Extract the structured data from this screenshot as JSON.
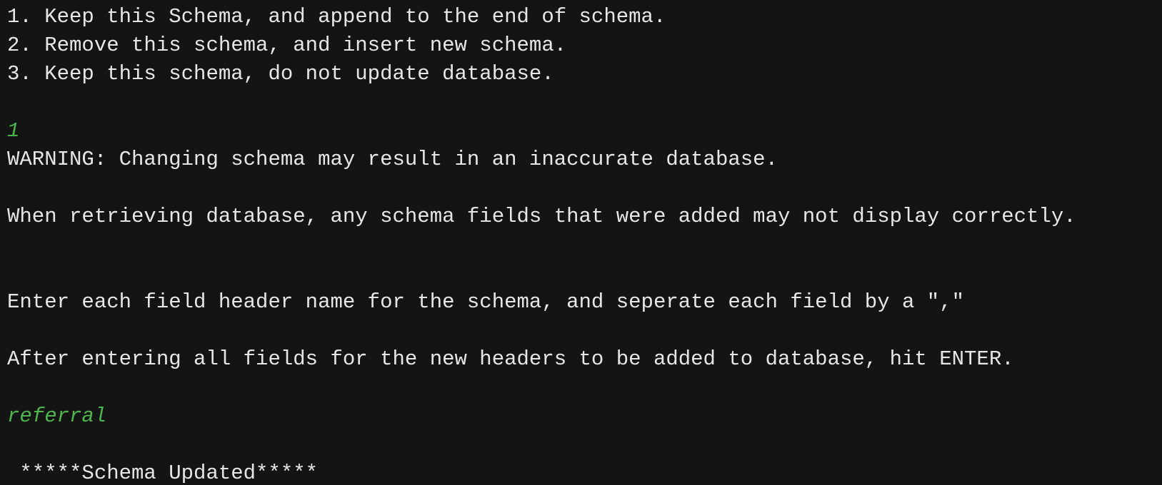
{
  "terminal": {
    "lines": [
      {
        "text": "1. Keep this Schema, and append to the end of schema.",
        "kind": "output"
      },
      {
        "text": "2. Remove this schema, and insert new schema.",
        "kind": "output"
      },
      {
        "text": "3. Keep this schema, do not update database.",
        "kind": "output"
      },
      {
        "text": "",
        "kind": "blank"
      },
      {
        "text": "1",
        "kind": "input"
      },
      {
        "text": "WARNING: Changing schema may result in an inaccurate database.",
        "kind": "output"
      },
      {
        "text": "",
        "kind": "blank"
      },
      {
        "text": "When retrieving database, any schema fields that were added may not display correctly.",
        "kind": "output"
      },
      {
        "text": "",
        "kind": "blank"
      },
      {
        "text": "",
        "kind": "blank"
      },
      {
        "text": "Enter each field header name for the schema, and seperate each field by a \",\"",
        "kind": "output"
      },
      {
        "text": "",
        "kind": "blank"
      },
      {
        "text": "After entering all fields for the new headers to be added to database, hit ENTER.",
        "kind": "output"
      },
      {
        "text": "",
        "kind": "blank"
      },
      {
        "text": "referral",
        "kind": "input"
      },
      {
        "text": "",
        "kind": "blank"
      },
      {
        "text": " *****Schema Updated*****",
        "kind": "output"
      }
    ],
    "colors": {
      "background": "#141414",
      "output_text": "#e6e6e6",
      "input_text": "#4fb54f"
    }
  }
}
